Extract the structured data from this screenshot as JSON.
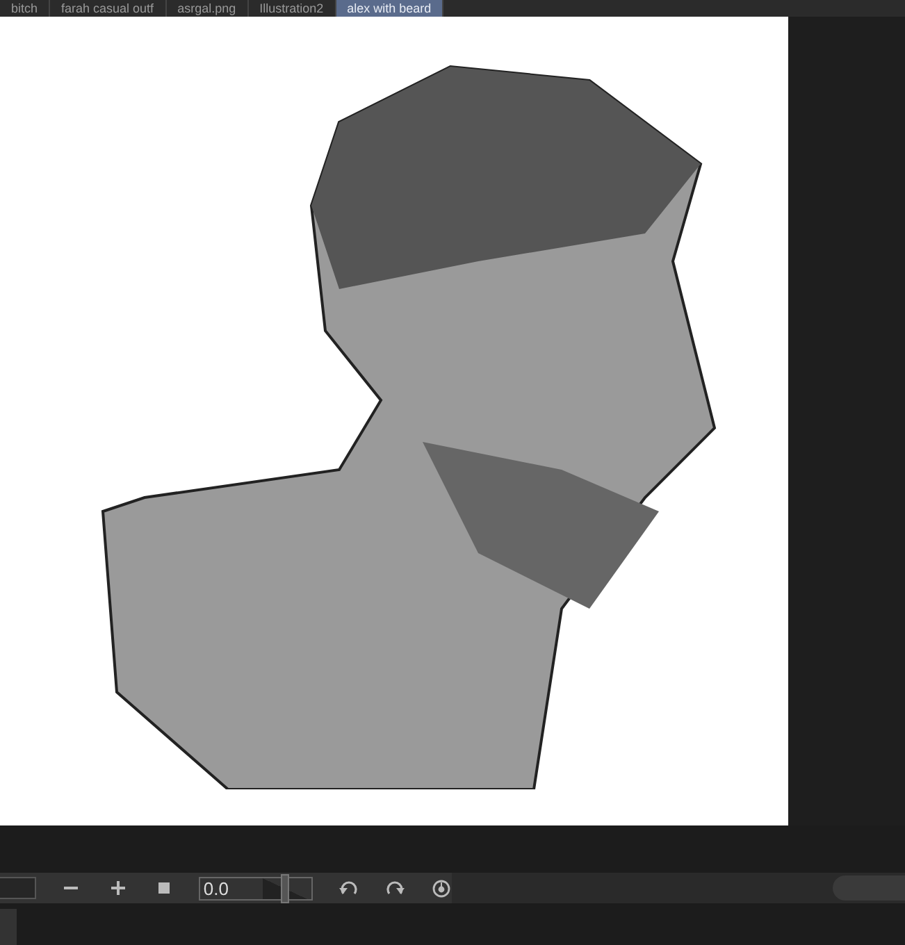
{
  "tabs": [
    {
      "label": "bitch",
      "selected": false
    },
    {
      "label": "farah casual outf",
      "selected": false
    },
    {
      "label": "asrgal.png",
      "selected": false
    },
    {
      "label": "Illustration2",
      "selected": false
    },
    {
      "label": "alex with beard",
      "selected": true
    }
  ],
  "toolbar": {
    "rotation_value": "0.0",
    "rotation": {
      "level": 0.5
    }
  }
}
